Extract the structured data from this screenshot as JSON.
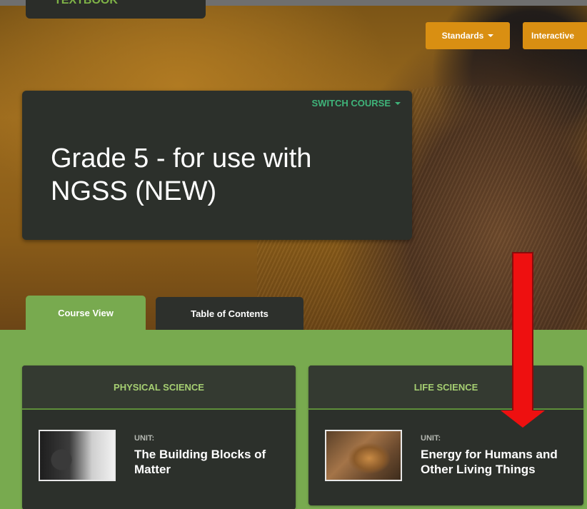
{
  "header": {
    "logo_text": "TEXTBOOK",
    "standards_label": "Standards",
    "interactive_label": "Interactive"
  },
  "course": {
    "switch_label": "SWITCH COURSE",
    "title": "Grade 5 - for use with NGSS (NEW)"
  },
  "tabs": [
    {
      "label": "Course View",
      "active": true
    },
    {
      "label": "Table of Contents",
      "active": false
    }
  ],
  "panels": [
    {
      "heading": "PHYSICAL SCIENCE",
      "unit_label": "UNIT:",
      "unit_title": "The Building Blocks of Matter",
      "thumbnail": "steam-train-image"
    },
    {
      "heading": "LIFE SCIENCE",
      "unit_label": "UNIT:",
      "unit_title": "Energy for Humans and Other Living Things",
      "thumbnail": "chipmunk-image"
    }
  ],
  "annotation": {
    "type": "arrow-down",
    "color": "#ee1010"
  },
  "colors": {
    "accent_orange": "#d98f12",
    "content_green": "#78aa4f",
    "panel_dark": "#2c302b",
    "switch_green": "#3fb47a"
  }
}
